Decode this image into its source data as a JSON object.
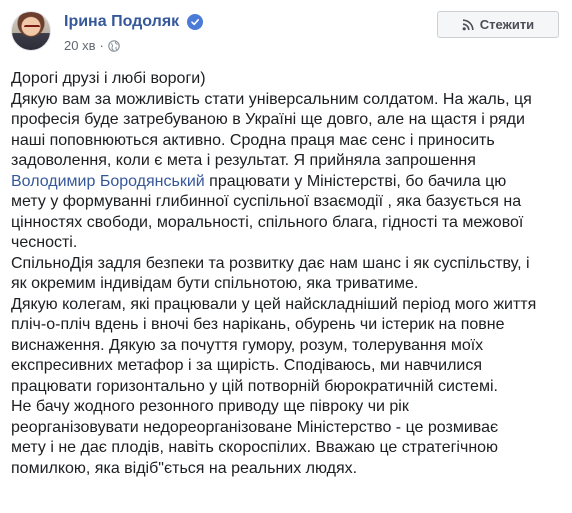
{
  "post": {
    "author": "Ірина Подоляк",
    "time": "20 хв",
    "separator": "·",
    "verified_icon": "verified-badge-icon",
    "privacy_icon": "globe-icon",
    "follow_icon": "rss-icon",
    "follow_label": "Стежити",
    "colors": {
      "link": "#365899",
      "badge": "#4a7bd6",
      "text": "#1c1e21",
      "meta": "#616770"
    },
    "lines": [
      "Дорогі друзі і любі вороги)",
      "Дякую вам за можливість стати універсальним солдатом. На жаль, ця",
      "професія буде затребуваною в Україні ще довго, але на щастя і ряди",
      "наші поповнюються активно. Сродна праця має сенс і приносить",
      "задоволення, коли є мета і результат. Я прийняла запрошення",
      {
        "mention": "Володимир Бородянський",
        "after": " працювати у Міністерстві, бо бачила цю"
      },
      "мету у формуванні глибинної суспільної взаємодії , яка базується на",
      "цінностях свободи, моральності, спільного блага, гідності та межової",
      "чесності.",
      "СпільноДія задля безпеки та розвитку дає нам шанс і як суспільству, і",
      "як окремим індивідам бути спільнотою, яка триватиме.",
      "Дякую колегам, які працювали у цей найскладніший період мого життя",
      "пліч-о-пліч вдень і вночі без нарікань, обурень чи істерик на повне",
      "виснаження. Дякую за почуття гумору, розум, толерування моїх",
      "експресивних метафор і за щирість. Сподіваюсь, ми навчилися",
      "працювати горизонтально у цій потворній бюрократичній системі.",
      "Не бачу жодного резонного приводу ще півроку чи рік",
      "реорганізовувати недореорганізоване Міністерство - це розмиває",
      "мету і не дає плодів, навіть скороспілих. Вважаю це стратегічною",
      "помилкою, яка відіб\"ється на реальних людях."
    ]
  }
}
